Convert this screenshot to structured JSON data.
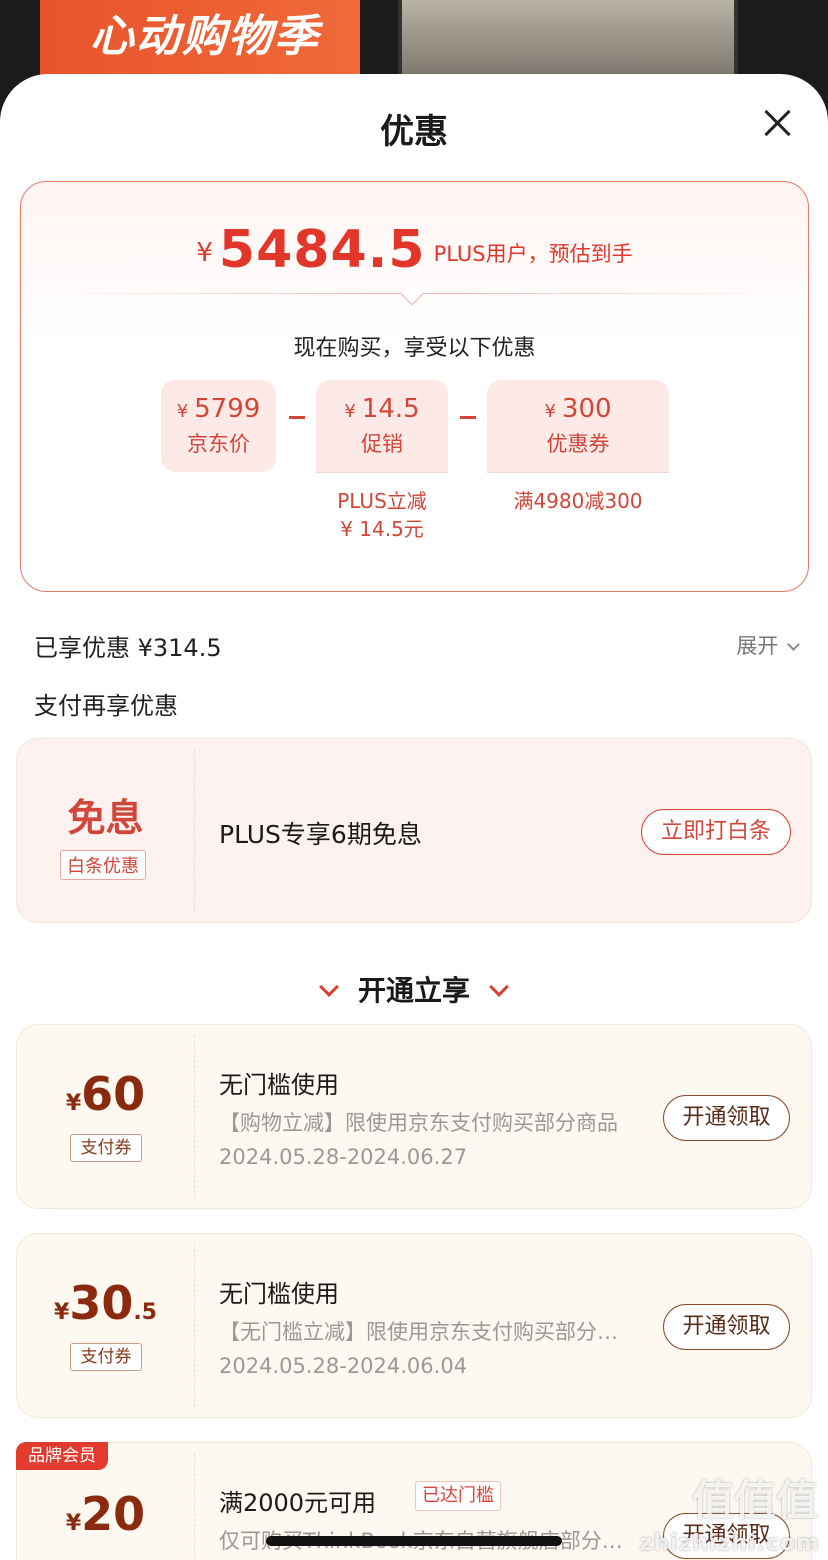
{
  "banner": {
    "title": "心动购物季"
  },
  "sheet": {
    "title": "优惠"
  },
  "summary": {
    "currency": "¥",
    "final_price": "5484.5",
    "final_note": "PLUS用户，预估到手",
    "buy_now_text": "现在购买，享受以下优惠",
    "items": [
      {
        "value": "5799",
        "label": "京东价",
        "detail": ""
      },
      {
        "value": "14.5",
        "label": "促销",
        "detail_line1": "PLUS立减",
        "detail_line2": "¥ 14.5元"
      },
      {
        "value": "300",
        "label": "优惠券",
        "detail": "满4980减300"
      }
    ]
  },
  "saved": {
    "label": "已享优惠 ¥314.5",
    "expand_label": "展开"
  },
  "pay_section": {
    "title": "支付再享优惠",
    "offer": {
      "headline": "免息",
      "tag": "白条优惠",
      "description": "PLUS专享6期免息",
      "button": "立即打白条"
    }
  },
  "open_section": {
    "title": "开通立享",
    "coupons": [
      {
        "currency": "¥",
        "amount": "60",
        "decimal": "",
        "tag": "支付券",
        "title": "无门槛使用",
        "desc": "【购物立减】限使用京东支付购买部分商品",
        "date": "2024.05.28-2024.06.27",
        "button": "开通领取"
      },
      {
        "currency": "¥",
        "amount": "30",
        "decimal": ".5",
        "tag": "支付券",
        "title": "无门槛使用",
        "desc": "【无门槛立减】限使用京东支付购买部分商品",
        "date": "2024.05.28-2024.06.04",
        "button": "开通领取"
      },
      {
        "currency": "¥",
        "amount": "20",
        "decimal": "",
        "brand_tag": "品牌会员",
        "title": "满2000元可用",
        "reached": "已达门槛",
        "desc": "仅可购买ThinkBook京东自营旗舰店部分商品",
        "button": "开通领取"
      }
    ]
  },
  "watermark": {
    "text": "zhizhizhi.com",
    "glyph": "值值值"
  },
  "colors": {
    "accent_red": "#e2362b",
    "coupon_brown": "#8a2b10",
    "pink_bg": "#fde9e6",
    "cream_bg": "#fdf8f0"
  }
}
